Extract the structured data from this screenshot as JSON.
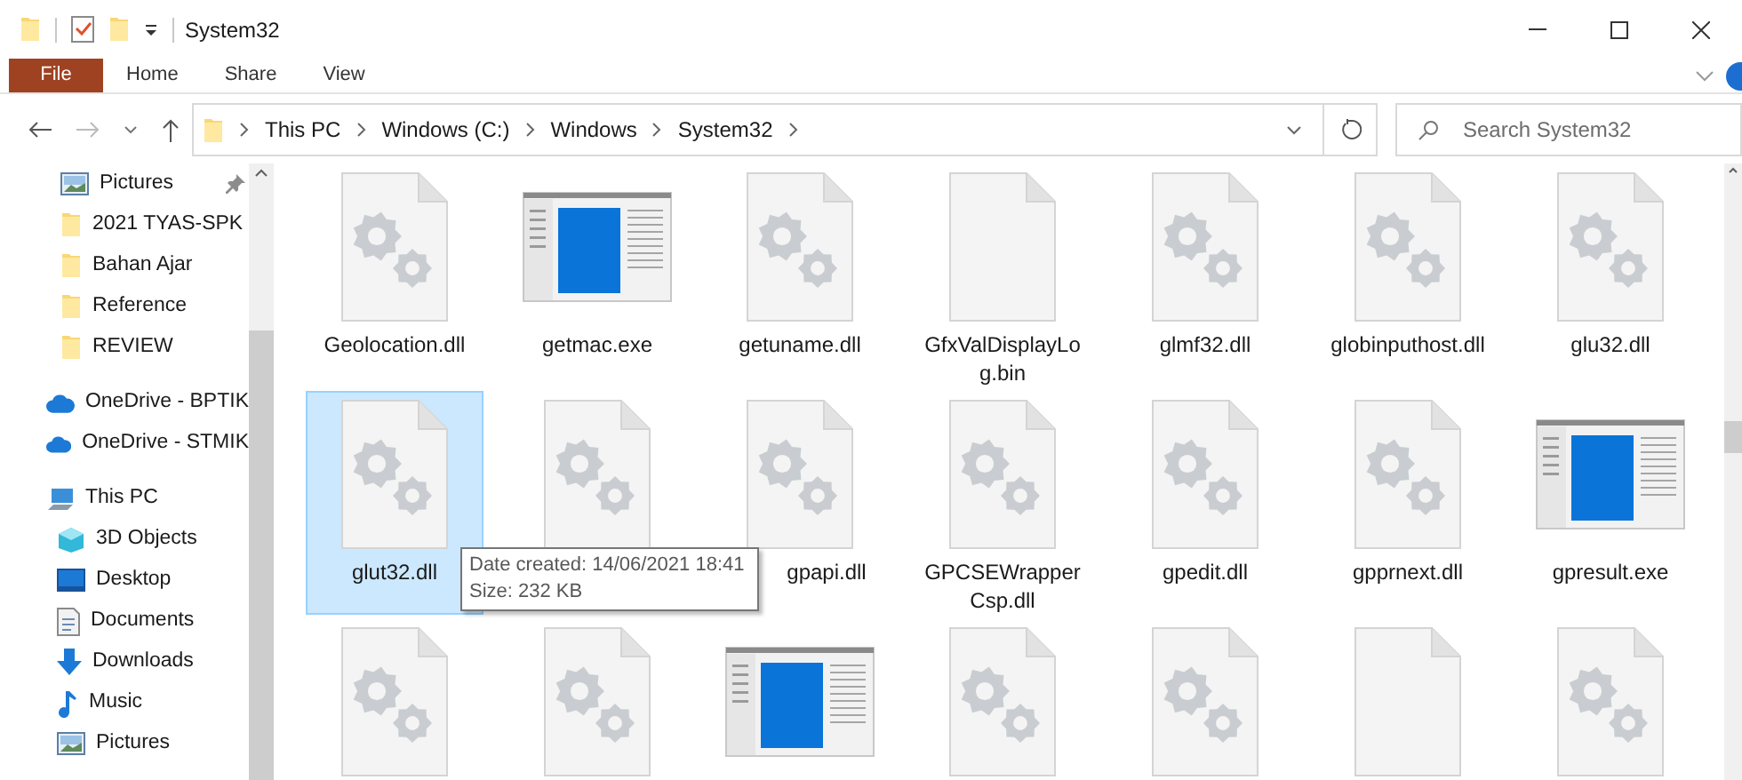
{
  "window": {
    "title": "System32"
  },
  "ribbon": {
    "tabs": [
      {
        "label": "File",
        "kind": "file"
      },
      {
        "label": "Home",
        "kind": "tab"
      },
      {
        "label": "Share",
        "kind": "tab"
      },
      {
        "label": "View",
        "kind": "tab"
      }
    ]
  },
  "address": {
    "path": [
      "This PC",
      "Windows (C:)",
      "Windows",
      "System32"
    ]
  },
  "search": {
    "placeholder": "Search System32"
  },
  "sidebar": {
    "items": [
      {
        "label": "Pictures",
        "kind": "pictures",
        "pinned": true
      },
      {
        "label": "2021 TYAS-SPK",
        "kind": "folder"
      },
      {
        "label": "Bahan Ajar",
        "kind": "folder"
      },
      {
        "label": "Reference",
        "kind": "folder"
      },
      {
        "label": "REVIEW",
        "kind": "folder"
      },
      {
        "label": "OneDrive - BPTIK",
        "kind": "cloud"
      },
      {
        "label": "OneDrive - STMIK",
        "kind": "cloud"
      },
      {
        "label": "This PC",
        "kind": "pc",
        "children": [
          {
            "label": "3D Objects",
            "kind": "cube"
          },
          {
            "label": "Desktop",
            "kind": "desktop"
          },
          {
            "label": "Documents",
            "kind": "documents"
          },
          {
            "label": "Downloads",
            "kind": "downloads"
          },
          {
            "label": "Music",
            "kind": "music"
          },
          {
            "label": "Pictures",
            "kind": "pictures"
          }
        ]
      }
    ]
  },
  "files": [
    {
      "name": "Geolocation.dll",
      "kind": "dll",
      "selected": false
    },
    {
      "name": "getmac.exe",
      "kind": "exe",
      "selected": false
    },
    {
      "name": "getuname.dll",
      "kind": "dll",
      "selected": false
    },
    {
      "name": "GfxValDisplayLog.bin",
      "kind": "file",
      "selected": false
    },
    {
      "name": "glmf32.dll",
      "kind": "dll",
      "selected": false
    },
    {
      "name": "globinputhost.dll",
      "kind": "dll",
      "selected": false
    },
    {
      "name": "glu32.dll",
      "kind": "dll",
      "selected": false
    },
    {
      "name": "glut32.dll",
      "kind": "dll",
      "selected": true
    },
    {
      "kind": "dll",
      "selected": false
    },
    {
      "name": "gpapi.dll",
      "kind": "dll",
      "selected": false
    },
    {
      "name": "GPCSEWrapperCsp.dll",
      "kind": "dll",
      "selected": false
    },
    {
      "name": "gpedit.dll",
      "kind": "dll",
      "selected": false
    },
    {
      "name": "gpprnext.dll",
      "kind": "dll",
      "selected": false
    },
    {
      "name": "gpresult.exe",
      "kind": "exe",
      "selected": false
    },
    {
      "kind": "dll",
      "selected": false
    },
    {
      "kind": "dll",
      "selected": false
    },
    {
      "kind": "exe",
      "selected": false
    },
    {
      "kind": "dll",
      "selected": false
    },
    {
      "kind": "dll",
      "selected": false
    },
    {
      "kind": "file",
      "selected": false
    },
    {
      "kind": "dll",
      "selected": false
    }
  ],
  "tooltip": {
    "lines": [
      "Date created: 14/06/2021 18:41",
      "Size: 232 KB"
    ]
  }
}
